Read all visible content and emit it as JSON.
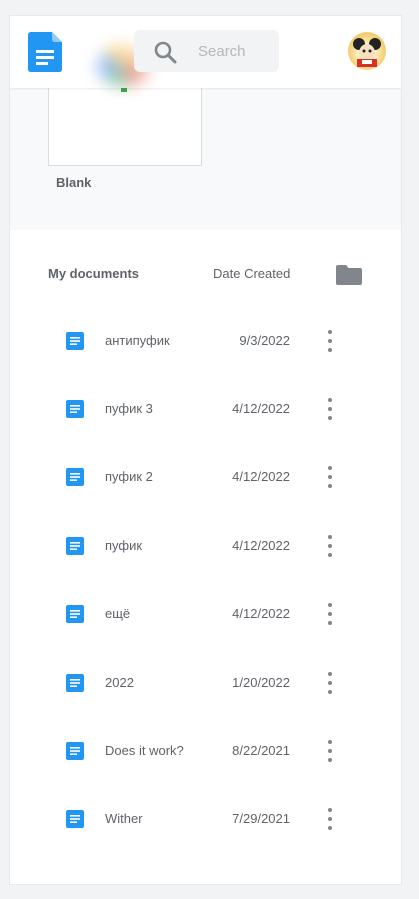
{
  "header": {
    "search_placeholder": "Search"
  },
  "templates": {
    "blank_label": "Blank"
  },
  "documents": {
    "title": "My documents",
    "sort_label": "Date Created",
    "items": [
      {
        "name": "антипуфик",
        "date": "9/3/2022"
      },
      {
        "name": "пуфик 3",
        "date": "4/12/2022"
      },
      {
        "name": "пуфик 2",
        "date": "4/12/2022"
      },
      {
        "name": "пуфик",
        "date": "4/12/2022"
      },
      {
        "name": "ещё",
        "date": "4/12/2022"
      },
      {
        "name": "2022",
        "date": "1/20/2022"
      },
      {
        "name": "Does it work?",
        "date": "8/22/2021"
      },
      {
        "name": "Wither",
        "date": "7/29/2021"
      }
    ]
  },
  "colors": {
    "docs_blue": "#2196f3",
    "text_gray": "#5f6368",
    "icon_gray": "#80868b"
  },
  "icons": {
    "logo": "docs-logo-icon",
    "search": "search-icon",
    "folder": "folder-icon",
    "document": "document-icon",
    "more": "more-vert-icon"
  }
}
